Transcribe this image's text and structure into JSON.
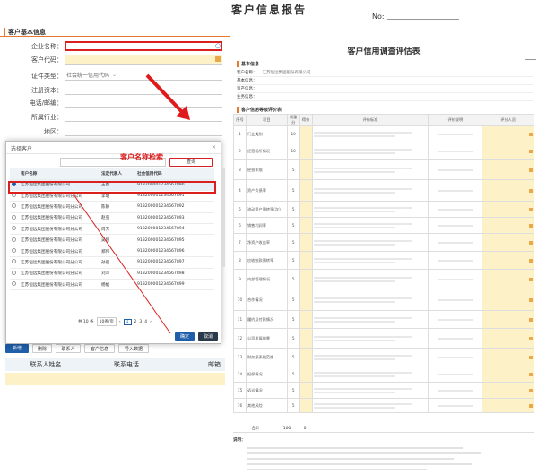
{
  "page": {
    "title": "客户信息报告",
    "no_label": "No:"
  },
  "left": {
    "section_basic": "客户基本信息",
    "fields": [
      {
        "label": "企业名称：",
        "value": "",
        "highlight": "red"
      },
      {
        "label": "客户代码：",
        "value": "",
        "highlight": "yellow"
      },
      {
        "label": "证件类型：",
        "value": "社会统一信用代码",
        "highlight": ""
      },
      {
        "label": "注册资本：",
        "value": "",
        "highlight": ""
      },
      {
        "label": "电话/邮编：",
        "value": "",
        "highlight": ""
      },
      {
        "label": "所属行业：",
        "value": "",
        "highlight": ""
      },
      {
        "label": "地区：",
        "value": "",
        "highlight": ""
      }
    ],
    "contacts_header": {
      "name": "联系人姓名",
      "phone": "联系电话",
      "email": "邮箱"
    },
    "toolbar": [
      "新增",
      "删除",
      "联系人",
      "客户信息",
      "导入数据"
    ]
  },
  "annotation": "客户名称检索",
  "modal": {
    "title": "选择客户",
    "query_button": "查询",
    "columns": [
      "客户名称",
      "法定代表人",
      "社会信用代码"
    ],
    "rows": [
      {
        "name": "江苏恒远集团股份有限公司",
        "rep": "王磊",
        "code": "913200001234567890",
        "selected": true
      },
      {
        "name": "江苏恒远集团股份有限公司分公司",
        "rep": "李明",
        "code": "913200001234567891",
        "selected": false
      },
      {
        "name": "江苏恒远集团股份有限公司分公司",
        "rep": "陈静",
        "code": "913200001234567892",
        "selected": false
      },
      {
        "name": "江苏恒远集团股份有限公司分公司",
        "rep": "赵强",
        "code": "913200001234567893",
        "selected": false
      },
      {
        "name": "江苏恒远集团股份有限公司分公司",
        "rep": "周芳",
        "code": "913200001234567894",
        "selected": false
      },
      {
        "name": "江苏恒远集团股份有限公司分公司",
        "rep": "吴刚",
        "code": "913200001234567895",
        "selected": false
      },
      {
        "name": "江苏恒远集团股份有限公司分公司",
        "rep": "郑伟",
        "code": "913200001234567896",
        "selected": false
      },
      {
        "name": "江苏恒远集团股份有限公司分公司",
        "rep": "孙丽",
        "code": "913200001234567897",
        "selected": false
      },
      {
        "name": "江苏恒远集团股份有限公司分公司",
        "rep": "刘洋",
        "code": "913200001234567898",
        "selected": false
      },
      {
        "name": "江苏恒远集团股份有限公司分公司",
        "rep": "杨帆",
        "code": "913200001234567899",
        "selected": false
      }
    ],
    "pagination": {
      "summary": "共 10 条",
      "per_page": "10条/页",
      "pages": [
        "1",
        "2",
        "3",
        "4"
      ]
    },
    "ok": "确定",
    "cancel": "取消"
  },
  "right": {
    "title": "客户信用调查评估表",
    "basic_label": "基本信息",
    "basic_rows": [
      "客户名称：",
      "基本信息：",
      "资产信息：",
      "业务信息："
    ],
    "company": "江苏恒远集团股份有限公司",
    "eval_label": "客户信用等级评价表",
    "table_head": [
      "序号",
      "项目",
      "权重分",
      "得分",
      "评价标准",
      "评价说明",
      "评分人员"
    ],
    "rows": [
      {
        "n": "1",
        "item": "行业类别",
        "w": "10"
      },
      {
        "n": "2",
        "item": "经营场所情况",
        "w": "10"
      },
      {
        "n": "3",
        "item": "经营年限",
        "w": "5"
      },
      {
        "n": "4",
        "item": "资产负债率",
        "w": "5"
      },
      {
        "n": "5",
        "item": "流动资产周转率(次)",
        "w": "5"
      },
      {
        "n": "6",
        "item": "销售利润率",
        "w": "5"
      },
      {
        "n": "7",
        "item": "净资产收益率",
        "w": "5"
      },
      {
        "n": "8",
        "item": "应收账款周转率",
        "w": "5"
      },
      {
        "n": "9",
        "item": "内部管理情况",
        "w": "5"
      },
      {
        "n": "10",
        "item": "合作情况",
        "w": "5"
      },
      {
        "n": "11",
        "item": "履约及付款情况",
        "w": "5"
      },
      {
        "n": "12",
        "item": "公司发展前景",
        "w": "5"
      },
      {
        "n": "13",
        "item": "财务报表规范性",
        "w": "5"
      },
      {
        "n": "14",
        "item": "担保情况",
        "w": "5"
      },
      {
        "n": "15",
        "item": "诉讼情况",
        "w": "5"
      },
      {
        "n": "16",
        "item": "其他风险",
        "w": "5"
      }
    ],
    "total_label": "合计",
    "total_value": "100",
    "total_score": "0",
    "notes_label": "说明："
  }
}
